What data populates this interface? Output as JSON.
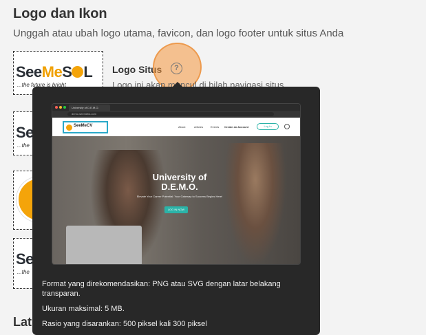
{
  "section": {
    "title": "Logo dan Ikon",
    "subtitle": "Unggah atau ubah logo utama, favicon, dan logo footer untuk situs Anda"
  },
  "logo_previews": [
    {
      "brand": "SeeMeSOL",
      "brand_prefix": "See",
      "brand_me": "Me",
      "brand_s": "S",
      "brand_l": "L",
      "tagline": "...the future is bright"
    },
    {
      "brand": "Se",
      "tagline": "...the"
    },
    {
      "brand": "",
      "tagline": ""
    },
    {
      "brand": "Se",
      "tagline": "...the"
    }
  ],
  "field": {
    "label": "Logo Situs",
    "help_icon": "help-circle-icon",
    "description": "Logo ini akan muncul di bilah navigasi situs"
  },
  "next_section_partial": "Lat",
  "tooltip": {
    "preview": {
      "tab_title": "University of D.E.M.O.",
      "url": "demo.seemebs.com",
      "site_logo": "SeeMeCV",
      "nav_links": [
        "About",
        "Articles",
        "Events",
        "Create an Account"
      ],
      "nav_button": "Log In",
      "hero_title": "University of D.E.M.O.",
      "hero_sub": "Elevate Your Career Potential: Your Gateway to Success Begins Here!",
      "hero_button": "LOG IN NOW"
    },
    "line1": "Format yang direkomendasikan: PNG atau SVG dengan latar belakang transparan.",
    "line2": "Ukuran maksimal: 5 MB.",
    "line3": "Rasio yang disarankan: 500 piksel kali 300 piksel"
  },
  "colors": {
    "accent_orange": "#f4a40a",
    "halo": "#f4963c",
    "teal": "#2bb3a8",
    "tooltip_bg": "#282828"
  }
}
